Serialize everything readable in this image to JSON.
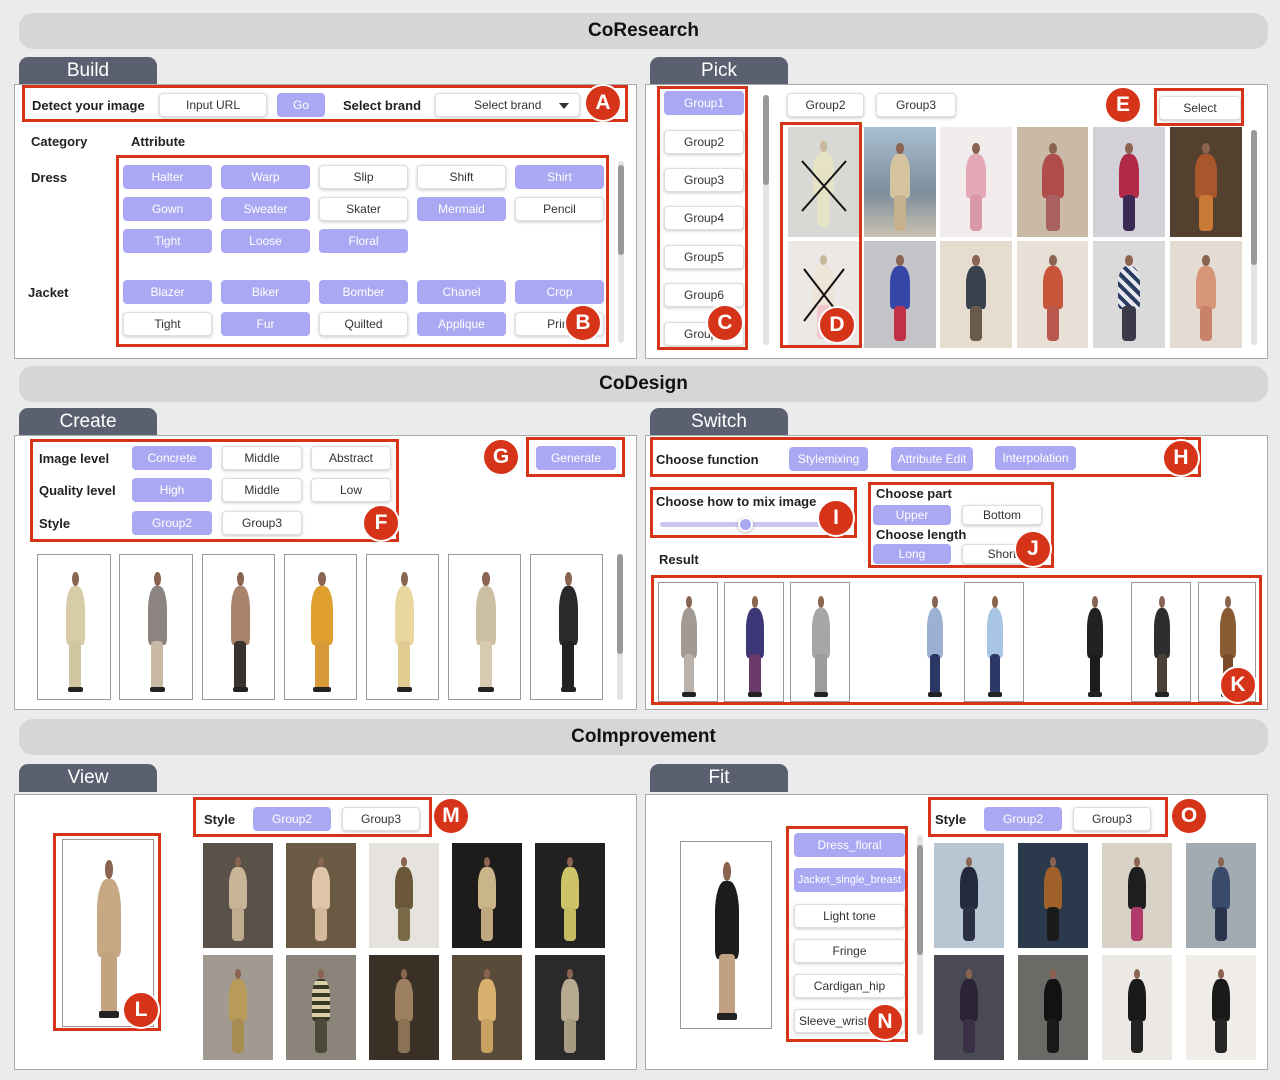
{
  "sections": {
    "coresearch": "CoResearch",
    "codesign": "CoDesign",
    "coimprovement": "CoImprovement"
  },
  "tabs": {
    "build": "Build",
    "pick": "Pick",
    "create": "Create",
    "switch": "Switch",
    "view": "View",
    "fit": "Fit"
  },
  "build": {
    "detect_label": "Detect your image",
    "input_url": "Input URL",
    "go": "Go",
    "brand_label": "Select brand",
    "brand_value": "Select brand",
    "category_header": "Category",
    "attribute_header": "Attribute",
    "dress_label": "Dress",
    "jacket_label": "Jacket",
    "dress_attrs": [
      "Halter",
      "Warp",
      "Slip",
      "Shift",
      "Shirt",
      "Gown",
      "Sweater",
      "Skater",
      "Mermaid",
      "Pencil",
      "Tight",
      "Loose",
      "Floral"
    ],
    "jacket_attrs": [
      "Blazer",
      "Biker",
      "Bomber",
      "Chanel",
      "Crop",
      "Tight",
      "Fur",
      "Quilted",
      "Applique",
      "Print"
    ]
  },
  "pick": {
    "groups": [
      "Group1",
      "Group2",
      "Group3",
      "Group4",
      "Group5",
      "Group6",
      "Group7"
    ],
    "top_groups": [
      "Group2",
      "Group3"
    ],
    "select": "Select"
  },
  "create": {
    "image_level_label": "Image level",
    "image_levels": [
      "Concrete",
      "Middle",
      "Abstract"
    ],
    "quality_label": "Quality level",
    "quality_levels": [
      "High",
      "Middle",
      "Low"
    ],
    "style_label": "Style",
    "styles": [
      "Group2",
      "Group3"
    ],
    "generate": "Generate"
  },
  "switch": {
    "function_label": "Choose function",
    "functions": [
      "Stylemixing",
      "Attribute Edit",
      "Interpolation"
    ],
    "mix_label": "Choose how to mix image",
    "mix_value": 0.5,
    "part_label": "Choose part",
    "parts": [
      "Upper",
      "Bottom"
    ],
    "length_label": "Choose length",
    "lengths": [
      "Long",
      "Short"
    ],
    "result_label": "Result"
  },
  "view": {
    "style_label": "Style",
    "styles": [
      "Group2",
      "Group3"
    ]
  },
  "fit": {
    "style_label": "Style",
    "styles": [
      "Group2",
      "Group3"
    ],
    "tags": [
      "Dress_floral",
      "Jacket_single_breast",
      "Light tone",
      "Fringe",
      "Cardigan_hip",
      "Sleeve_wrist_"
    ]
  },
  "badges": [
    "A",
    "B",
    "C",
    "D",
    "E",
    "F",
    "G",
    "H",
    "I",
    "J",
    "K",
    "L",
    "M",
    "N",
    "O"
  ],
  "colors": {
    "accent": "#aaa8f2",
    "annotation": "#d63418",
    "tab": "#5a6070",
    "banner": "#d6d6d6"
  }
}
